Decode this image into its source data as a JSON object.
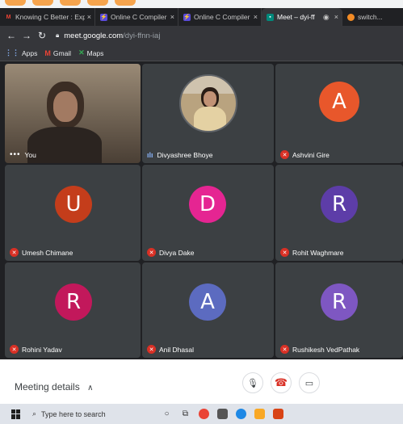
{
  "browser": {
    "tabs": [
      {
        "title": "Knowing C Better : Expert Lect",
        "favicon": "gmail-icon",
        "active": false
      },
      {
        "title": "Online C Compiler - online edi",
        "favicon": "compiler-icon",
        "active": false
      },
      {
        "title": "Online C Compiler - online edi",
        "favicon": "compiler-icon",
        "active": false
      },
      {
        "title": "Meet – dyi-ffnn-iaj",
        "favicon": "meet-icon",
        "active": true
      },
      {
        "title": "switch...",
        "favicon": "switch-icon",
        "active": false
      }
    ],
    "address": {
      "host": "meet.google.com",
      "path": "/dyi-ffnn-iaj"
    },
    "bookmarks": [
      {
        "label": "Apps",
        "icon": "apps-grid-icon"
      },
      {
        "label": "Gmail",
        "icon": "gmail-icon"
      },
      {
        "label": "Maps",
        "icon": "maps-icon"
      }
    ]
  },
  "participants": [
    {
      "name": "You",
      "type": "video",
      "muted": false
    },
    {
      "name": "Divyashree Bhoye",
      "type": "photo",
      "muted": false,
      "speaking": true
    },
    {
      "name": "Ashvini Gire",
      "initial": "A",
      "color": "#e8572b",
      "muted": true
    },
    {
      "name": "Umesh Chimane",
      "initial": "U",
      "color": "#c43d1b",
      "muted": true
    },
    {
      "name": "Divya Dake",
      "initial": "D",
      "color": "#e52592",
      "muted": true
    },
    {
      "name": "Rohit Waghmare",
      "initial": "R",
      "color": "#5d3da8",
      "muted": true
    },
    {
      "name": "Rohini Yadav",
      "initial": "R",
      "color": "#c2185b",
      "muted": true
    },
    {
      "name": "Anil Dhasal",
      "initial": "A",
      "color": "#5c6bc0",
      "muted": true
    },
    {
      "name": "Rushikesh VedPathak",
      "initial": "R",
      "color": "#7e57c2",
      "muted": true
    }
  ],
  "controls": {
    "meeting_details": "Meeting details",
    "meeting_details_icon": "chevron-up-icon",
    "buttons": [
      "microphone-icon",
      "hang-up-icon",
      "camera-icon"
    ],
    "hangup_color": "#d93025"
  },
  "taskbar": {
    "search_placeholder": "Type here to search"
  }
}
